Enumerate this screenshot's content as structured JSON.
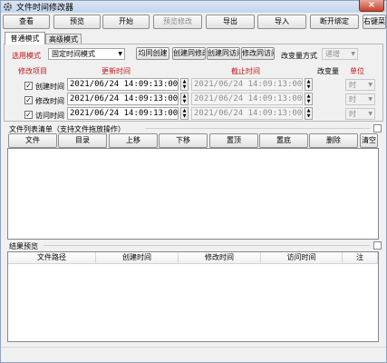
{
  "window": {
    "title": "文件时间修改器",
    "close_label": "×"
  },
  "toolbar": {
    "view": "查看",
    "preview": "预览",
    "start": "开始",
    "preview_modify": "预览修改",
    "export": "导出",
    "import": "导入",
    "unbind": "断开绑定",
    "right_key": "右键菜"
  },
  "tabs": {
    "normal": "普通模式",
    "advanced": "高级模式"
  },
  "mode": {
    "label": "选用模式",
    "value": "固定时间模式",
    "btn_equal_create": "均同创建",
    "btn_create_same_modify": "创建同修改",
    "btn_create_same_access": "创建同访问",
    "btn_modify_same_access": "修改同访问",
    "change_method_label": "改变量方式",
    "change_method_value": "递增"
  },
  "columns": {
    "item": "修改项目",
    "new_time": "更新时间",
    "end_time": "截止时间",
    "change": "改变量",
    "unit": "单位"
  },
  "rows": [
    {
      "label": "创建时间",
      "checked": "✓",
      "new_time": "2021/06/24 14:09:13:000",
      "end_time": "2021/06/24 14:09:13:000",
      "unit": "时"
    },
    {
      "label": "修改时间",
      "checked": "✓",
      "new_time": "2021/06/24 14:09:13:000",
      "end_time": "2021/06/24 14:09:13:000",
      "unit": "时"
    },
    {
      "label": "访问时间",
      "checked": "✓",
      "new_time": "2021/06/24 14:09:13:000",
      "end_time": "2021/06/24 14:09:13:000",
      "unit": "时"
    }
  ],
  "file_list": {
    "title": "文件列表清单（支持文件拖放操作）",
    "buttons": {
      "file": "文件",
      "dir": "目录",
      "up": "上移",
      "down": "下移",
      "top": "置顶",
      "bottom": "置底",
      "delete": "删除",
      "clear": "清空"
    }
  },
  "results": {
    "title": "结果预览",
    "headers": {
      "path": "文件路径",
      "create": "创建时间",
      "modify": "修改时间",
      "access": "访问时间",
      "note": "注"
    }
  }
}
